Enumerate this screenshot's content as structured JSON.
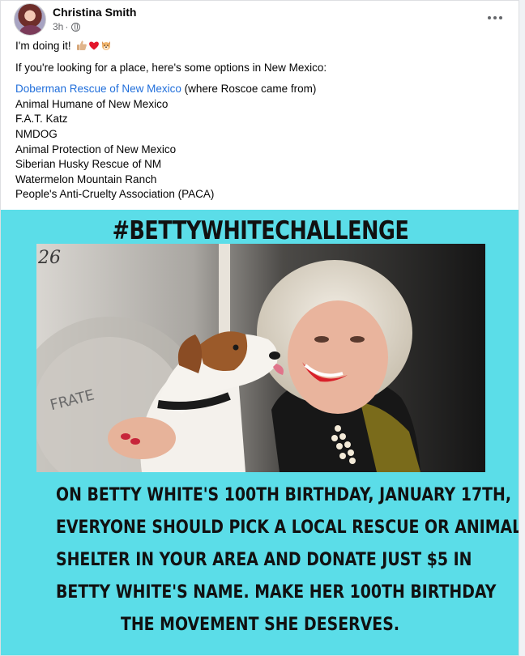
{
  "post": {
    "author": "Christina Smith",
    "time": "3h",
    "separator": "·",
    "audience_icon": "globe-icon",
    "menu_icon": "more-options-icon"
  },
  "body": {
    "line1": "I'm doing it!",
    "emojis": [
      "thumbs-up-emoji",
      "red-heart-emoji",
      "dog-face-emoji"
    ],
    "intro": "If you're looking for a place, here's some options in New Mexico:",
    "first_link": "Doberman Rescue of New Mexico",
    "first_suffix": " (where Roscoe came from)",
    "options": [
      "Animal Humane of New Mexico",
      "F.A.T. Katz",
      "NMDOG",
      "Animal Protection of New Mexico",
      "Siberian Husky Rescue of NM",
      "Watermelon Mountain Ranch",
      "People's Anti-Cruelty Association (PACA)"
    ]
  },
  "image": {
    "background_color": "#5bdde8",
    "title": "#BETTYWHITECHALLENGE",
    "photo_sign_text": "26",
    "photo_banner_text": "FRATE",
    "caption_lines": [
      "ON BETTY WHITE'S 100TH BIRTHDAY, JANUARY 17TH,",
      "EVERYONE SHOULD PICK A LOCAL RESCUE OR ANIMAL",
      "SHELTER IN YOUR AREA AND DONATE JUST $5 IN",
      "BETTY WHITE'S NAME. MAKE HER 100TH BIRTHDAY",
      "THE MOVEMENT SHE DESERVES."
    ]
  }
}
